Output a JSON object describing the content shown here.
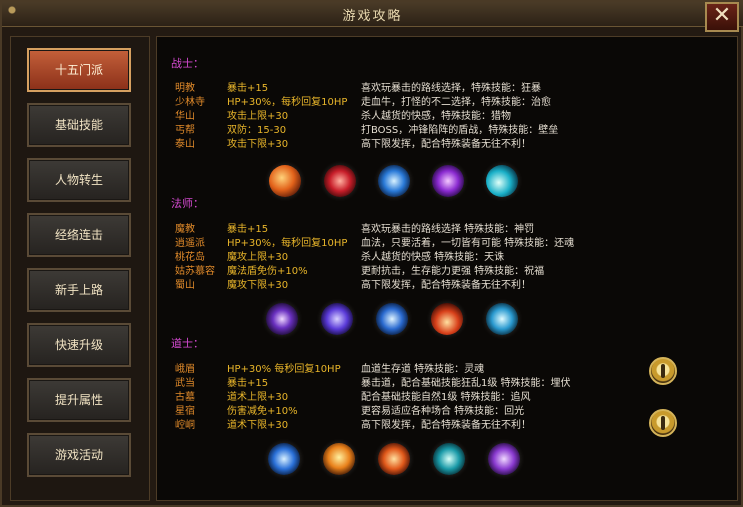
{
  "window": {
    "title": "游戏攻略",
    "close_label": "✕"
  },
  "sidebar": {
    "items": [
      {
        "label": "十五门派",
        "active": true
      },
      {
        "label": "基础技能",
        "active": false
      },
      {
        "label": "人物转生",
        "active": false
      },
      {
        "label": "经络连击",
        "active": false
      },
      {
        "label": "新手上路",
        "active": false
      },
      {
        "label": "快速升级",
        "active": false
      },
      {
        "label": "提升属性",
        "active": false
      },
      {
        "label": "游戏活动",
        "active": false
      }
    ]
  },
  "sections": [
    {
      "title": "战士：",
      "rows": [
        {
          "name": "明教",
          "stat": "暴击+15",
          "desc": "喜欢玩暴击的路线选择，特殊技能：狂暴"
        },
        {
          "name": "少林寺",
          "stat": "HP+30%，每秒回复10HP",
          "desc": "走血牛，打怪的不二选择，特殊技能：治愈"
        },
        {
          "name": "华山",
          "stat": "攻击上限+30",
          "desc": "杀人越货的快感，特殊技能：猎物"
        },
        {
          "name": "丐帮",
          "stat": "双防：15-30",
          "desc": "打BOSS，冲锋陷阵的盾战，特殊技能：壁垒"
        },
        {
          "name": "泰山",
          "stat": "攻击下限+30",
          "desc": "高下限发挥，配合特殊装备无往不利！"
        }
      ],
      "skill_icons": [
        "fire-slash-icon",
        "red-burst-icon",
        "blue-arrows-icon",
        "purple-fist-icon",
        "cyan-sword-icon"
      ]
    },
    {
      "title": "法师：",
      "rows": [
        {
          "name": "魔教",
          "stat": "暴击+15",
          "desc": "喜欢玩暴击的路线选择   特殊技能：神罚"
        },
        {
          "name": "逍遥派",
          "stat": "HP+30%，每秒回复10HP",
          "desc": "血法，只要活着，一切皆有可能   特殊技能：还魂"
        },
        {
          "name": "桃花岛",
          "stat": "魔攻上限+30",
          "desc": "杀人越货的快感   特殊技能：天诛"
        },
        {
          "name": "姑苏慕容",
          "stat": "魔法盾免伤+10%",
          "desc": "更耐抗击，生存能力更强    特殊技能：祝福"
        },
        {
          "name": "蜀山",
          "stat": "魔攻下限+30",
          "desc": "高下限发挥，配合特殊装备无往不利！"
        }
      ],
      "skill_icons": [
        "purple-star-icon",
        "violet-orb-icon",
        "blue-lightning-icon",
        "red-flame-icon",
        "cyan-blades-icon"
      ]
    },
    {
      "title": "道士：",
      "rows": [
        {
          "name": "峨眉",
          "stat": "HP+30% 每秒回复10HP",
          "desc": "血道生存道   特殊技能：灵魂"
        },
        {
          "name": "武当",
          "stat": "暴击+15",
          "desc": "暴击道，配合基础技能狂乱1级  特殊技能：埋伏"
        },
        {
          "name": "古墓",
          "stat": "道术上限+30",
          "desc": "配合基础技能自然1级  特殊技能：追风"
        },
        {
          "name": "星宿",
          "stat": "伤害减免+10%",
          "desc": "更容易适应各种场合     特殊技能：回光"
        },
        {
          "name": "崆峒",
          "stat": "道术下限+30",
          "desc": "高下限发挥，配合特殊装备无往不利！"
        }
      ],
      "skill_icons": [
        "blue-swirl-icon",
        "fire-figure-icon",
        "running-figure-icon",
        "teal-wave-icon",
        "purple-shield-icon"
      ],
      "badges": [
        "gold-figure-badge-icon",
        "gold-figure-badge-icon"
      ]
    }
  ],
  "colors": {
    "section_title": "#d44ad0",
    "name": "#e08a2a",
    "stat": "#e8b52a",
    "desc": "#e4ddd0",
    "active_tab": "#b8502e"
  }
}
